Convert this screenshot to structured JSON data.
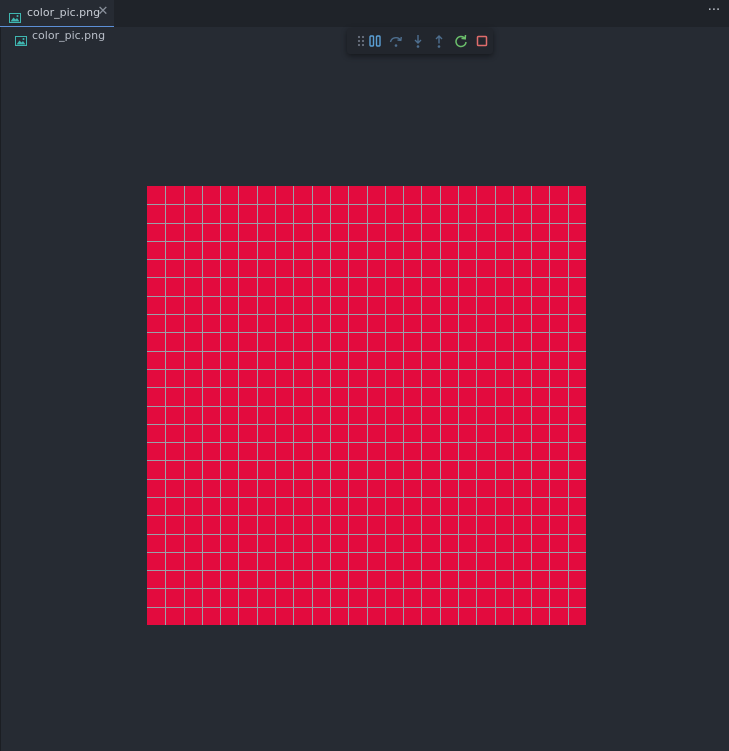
{
  "editor": {
    "tab": {
      "icon": "image-file-icon",
      "label": "color_pic.png",
      "close_icon": "close-icon",
      "close_glyph": "✕"
    },
    "more_actions": {
      "icon": "ellipsis-icon",
      "glyph": "···"
    },
    "breadcrumb": {
      "icon": "image-file-icon",
      "label": "color_pic.png"
    }
  },
  "debug_toolbar": {
    "buttons": [
      {
        "icon": "drag-handle-icon",
        "color": "#6b7280"
      },
      {
        "icon": "pause-icon",
        "color": "#5a9fd4"
      },
      {
        "icon": "step-over-icon",
        "color": "#4e6f8f"
      },
      {
        "icon": "step-into-icon",
        "color": "#4e6f8f"
      },
      {
        "icon": "step-out-icon",
        "color": "#4e6f8f"
      },
      {
        "icon": "restart-icon",
        "color": "#6bbf6b"
      },
      {
        "icon": "stop-icon",
        "color": "#e06c6c"
      }
    ]
  },
  "image_preview": {
    "fill_color": "#e30b3e",
    "grid_color": "#9aa0a8",
    "grid_cells": 24
  }
}
